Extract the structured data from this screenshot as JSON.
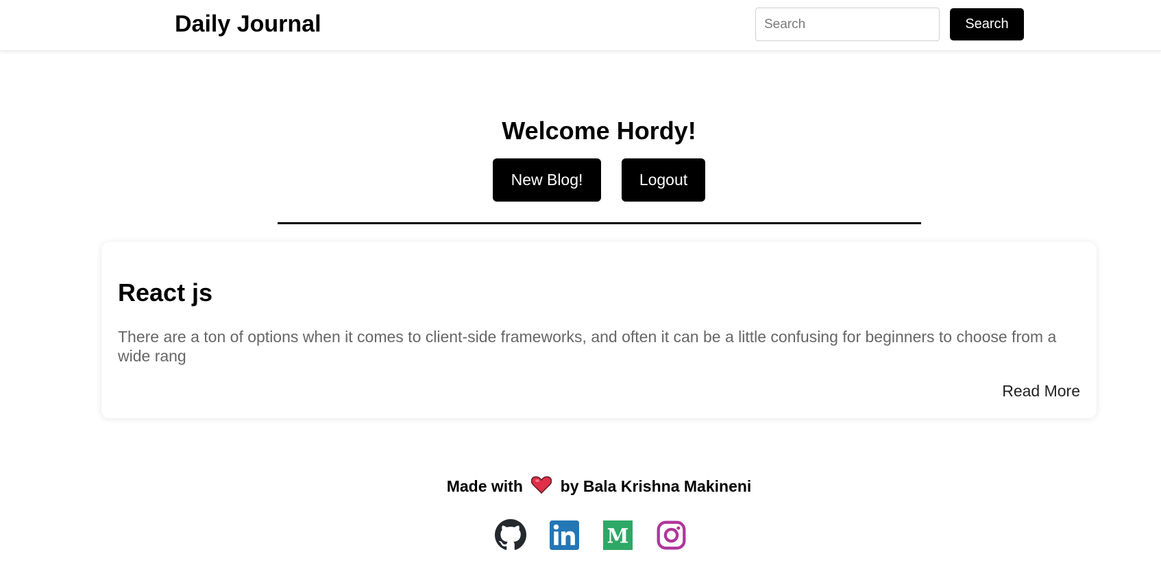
{
  "header": {
    "brand": "Daily Journal",
    "search_placeholder": "Search",
    "search_button": "Search"
  },
  "welcome": {
    "title": "Welcome Hordy!",
    "new_blog_label": "New Blog!",
    "logout_label": "Logout"
  },
  "posts": [
    {
      "title": "React js",
      "excerpt": "There are a ton of options when it comes to client-side frameworks, and often it can be a little confusing for beginners to choose from a wide rang",
      "read_more": "Read More"
    }
  ],
  "footer": {
    "made_with": "Made with",
    "by": "by Bala Krishna Makineni",
    "socials": [
      {
        "icon": "github-icon",
        "color": "#24292e"
      },
      {
        "icon": "linkedin-icon",
        "color": "#2377b5"
      },
      {
        "icon": "medium-icon",
        "color": "#2ea866"
      },
      {
        "icon": "instagram-icon",
        "color": "#b0369c"
      }
    ]
  },
  "colors": {
    "primary_button": "#000000",
    "excerpt_text": "#666666",
    "heart": "#e0304a"
  }
}
